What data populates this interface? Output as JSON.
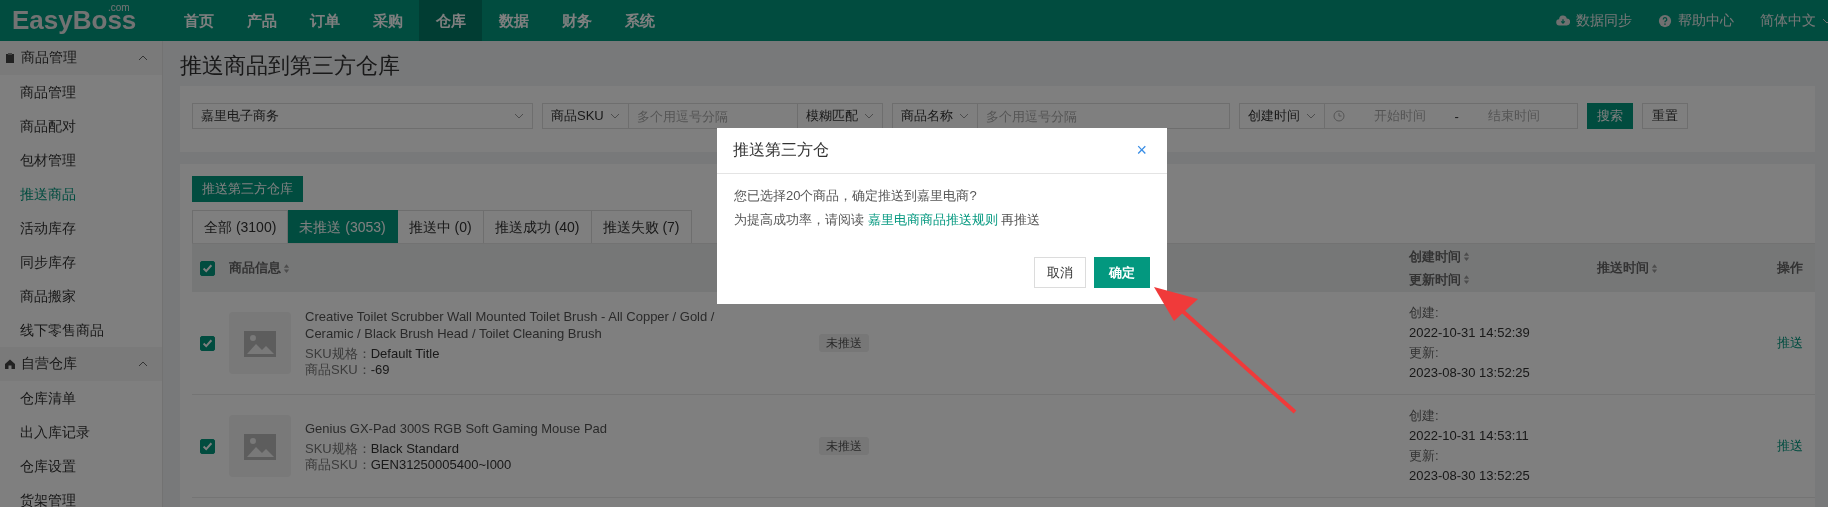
{
  "logo": {
    "text": "EasyBoss",
    "suffix": ".com"
  },
  "nav": [
    {
      "label": "首页",
      "selected": false
    },
    {
      "label": "产品",
      "selected": false
    },
    {
      "label": "订单",
      "selected": false
    },
    {
      "label": "采购",
      "selected": false
    },
    {
      "label": "仓库",
      "selected": true
    },
    {
      "label": "数据",
      "selected": false
    },
    {
      "label": "财务",
      "selected": false
    },
    {
      "label": "系统",
      "selected": false
    }
  ],
  "header_links": [
    {
      "kind": "cloud",
      "label": "数据同步"
    },
    {
      "kind": "help",
      "label": "帮助中心"
    }
  ],
  "language": "简体中文",
  "sidebar": [
    {
      "kind": "goods",
      "label": "商品管理",
      "expanded": true,
      "children": [
        {
          "label": "商品管理",
          "selected": false
        },
        {
          "label": "商品配对",
          "selected": false
        },
        {
          "label": "包材管理",
          "selected": false
        },
        {
          "label": "推送商品",
          "selected": true
        },
        {
          "label": "活动库存",
          "selected": false
        },
        {
          "label": "同步库存",
          "selected": false
        },
        {
          "label": "商品搬家",
          "selected": false
        },
        {
          "label": "线下零售商品",
          "selected": false
        }
      ]
    },
    {
      "kind": "warehouse",
      "label": "自营仓库",
      "expanded": true,
      "children": [
        {
          "label": "仓库清单",
          "selected": false
        },
        {
          "label": "出入库记录",
          "selected": false
        },
        {
          "label": "仓库设置",
          "selected": false
        },
        {
          "label": "货架管理",
          "selected": false
        }
      ]
    }
  ],
  "page_title": "推送商品到第三方仓库",
  "filters": {
    "store": "嘉里电子商务",
    "sku_type": "商品SKU",
    "sku_placeholder": "多个用逗号分隔",
    "match": "模糊匹配",
    "name_type": "商品名称",
    "name_placeholder": "多个用逗号分隔",
    "date_type": "创建时间",
    "start_placeholder": "开始时间",
    "separator": "-",
    "end_placeholder": "结束时间",
    "search": "搜索",
    "reset": "重置"
  },
  "push_button": "推送第三方仓库",
  "tabs": [
    {
      "label": "全部 (3100)",
      "selected": false
    },
    {
      "label": "未推送 (3053)",
      "selected": true
    },
    {
      "label": "推送中 (0)",
      "selected": false
    },
    {
      "label": "推送成功 (40)",
      "selected": false
    },
    {
      "label": "推送失败 (7)",
      "selected": false
    }
  ],
  "table": {
    "all_checked": true,
    "headers": {
      "info": "商品信息",
      "created": "创建时间",
      "updated": "更新时间",
      "push_time": "推送时间",
      "action": "操作"
    },
    "rows": [
      {
        "checked": true,
        "title": "Creative Toilet Scrubber Wall Mounted Toilet Brush - All Copper / Gold / Ceramic / Black Brush Head / Toilet Cleaning Brush",
        "spec_label": "SKU规格：",
        "spec": "Default Title",
        "sku_label": "商品SKU：",
        "sku": "-69",
        "status": "未推送",
        "created_label": "创建:",
        "created": "2022-10-31 14:52:39",
        "updated_label": "更新:",
        "updated": "2023-08-30 13:52:25",
        "action": "推送"
      },
      {
        "checked": true,
        "title": "Genius GX-Pad 300S RGB Soft Gaming Mouse Pad",
        "spec_label": "SKU规格：",
        "spec": "Black Standard",
        "sku_label": "商品SKU：",
        "sku": "GEN31250005400~I000",
        "status": "未推送",
        "created_label": "创建:",
        "created": "2022-10-31 14:53:11",
        "updated_label": "更新:",
        "updated": "2023-08-30 13:52:25",
        "action": "推送"
      }
    ]
  },
  "dialog": {
    "title": "推送第三方仓",
    "close": "×",
    "message": "您已选择20个商品，确定推送到嘉里电商?",
    "hint_prefix": "为提高成功率，请阅读 ",
    "hint_link": "嘉里电商商品推送规则",
    "hint_suffix": " 再推送",
    "cancel": "取消",
    "confirm": "确定"
  }
}
